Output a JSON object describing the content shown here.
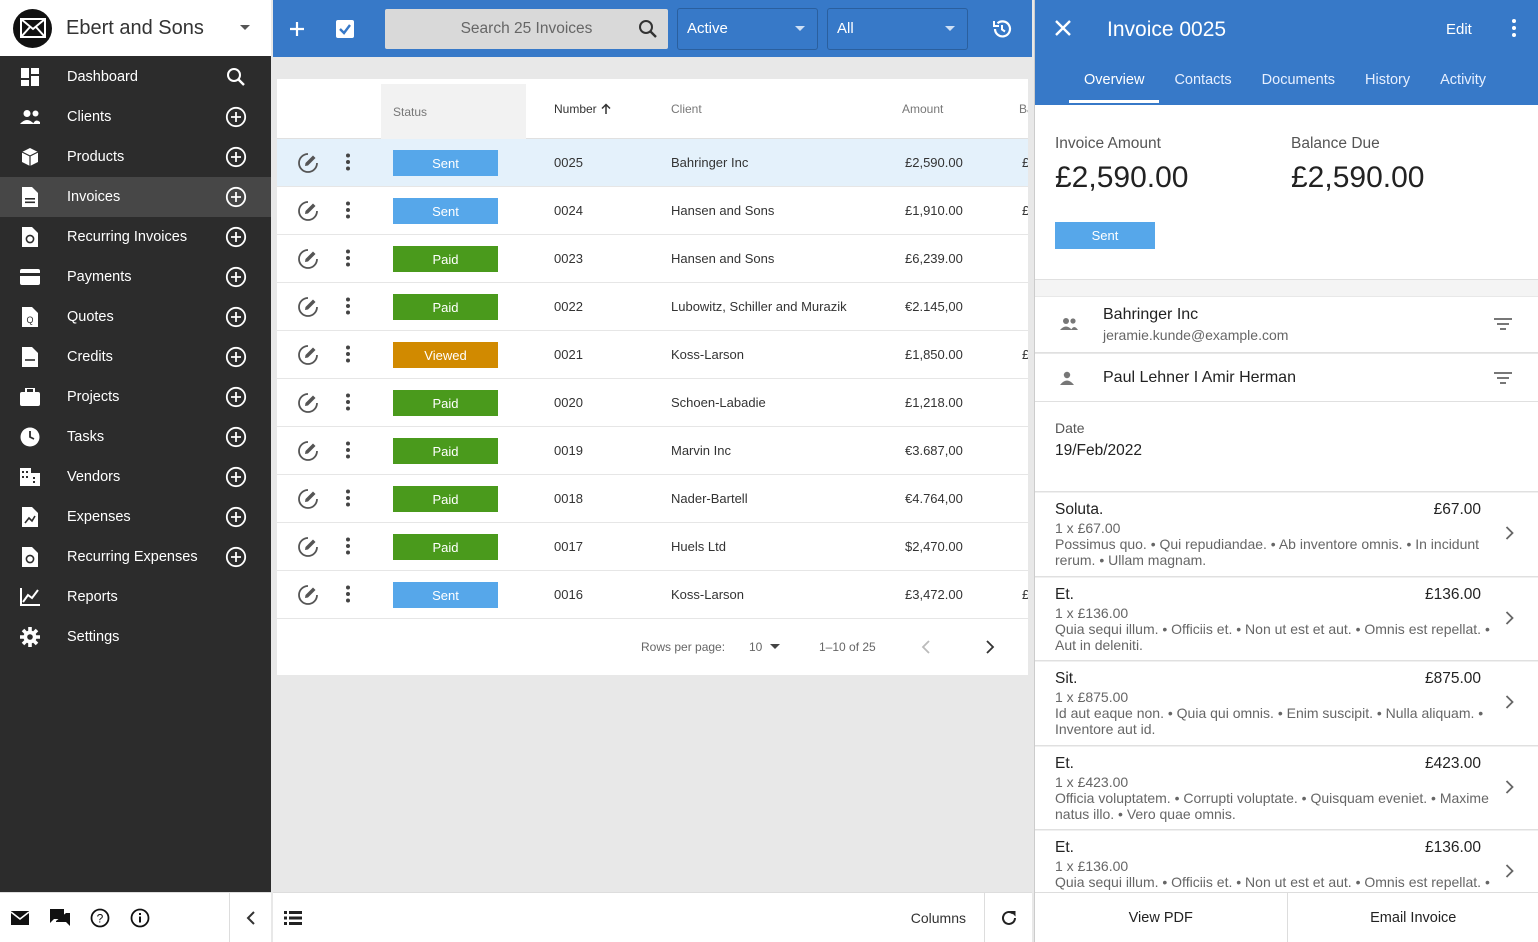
{
  "company": {
    "name": "Ebert and Sons"
  },
  "nav": [
    {
      "label": "Dashboard",
      "icon": "dashboard-icon",
      "action": "search"
    },
    {
      "label": "Clients",
      "icon": "clients-icon",
      "action": "add"
    },
    {
      "label": "Products",
      "icon": "products-icon",
      "action": "add"
    },
    {
      "label": "Invoices",
      "icon": "invoices-icon",
      "action": "add",
      "active": true
    },
    {
      "label": "Recurring Invoices",
      "icon": "recurring-invoices-icon",
      "action": "add"
    },
    {
      "label": "Payments",
      "icon": "payments-icon",
      "action": "add"
    },
    {
      "label": "Quotes",
      "icon": "quotes-icon",
      "action": "add"
    },
    {
      "label": "Credits",
      "icon": "credits-icon",
      "action": "add"
    },
    {
      "label": "Projects",
      "icon": "projects-icon",
      "action": "add"
    },
    {
      "label": "Tasks",
      "icon": "tasks-icon",
      "action": "add"
    },
    {
      "label": "Vendors",
      "icon": "vendors-icon",
      "action": "add"
    },
    {
      "label": "Expenses",
      "icon": "expenses-icon",
      "action": "add"
    },
    {
      "label": "Recurring Expenses",
      "icon": "recurring-expenses-icon",
      "action": "add"
    },
    {
      "label": "Reports",
      "icon": "reports-icon",
      "action": "none"
    },
    {
      "label": "Settings",
      "icon": "settings-icon",
      "action": "none"
    }
  ],
  "topbar": {
    "search_placeholder": "Search 25 Invoices",
    "state_filter": "Active",
    "status_filter": "All"
  },
  "table": {
    "headers": {
      "status": "Status",
      "number": "Number",
      "client": "Client",
      "amount": "Amount",
      "balance": "Ba"
    },
    "rows": [
      {
        "status": "Sent",
        "number": "0025",
        "client": "Bahringer Inc",
        "amount": "£2,590.00",
        "balance": "£",
        "selected": true
      },
      {
        "status": "Sent",
        "number": "0024",
        "client": "Hansen and Sons",
        "amount": "£1,910.00",
        "balance": "£"
      },
      {
        "status": "Paid",
        "number": "0023",
        "client": "Hansen and Sons",
        "amount": "£6,239.00",
        "balance": ""
      },
      {
        "status": "Paid",
        "number": "0022",
        "client": "Lubowitz, Schiller and Murazik",
        "amount": "€2.145,00",
        "balance": ""
      },
      {
        "status": "Viewed",
        "number": "0021",
        "client": "Koss-Larson",
        "amount": "£1,850.00",
        "balance": "£"
      },
      {
        "status": "Paid",
        "number": "0020",
        "client": "Schoen-Labadie",
        "amount": "£1,218.00",
        "balance": ""
      },
      {
        "status": "Paid",
        "number": "0019",
        "client": "Marvin Inc",
        "amount": "€3.687,00",
        "balance": ""
      },
      {
        "status": "Paid",
        "number": "0018",
        "client": "Nader-Bartell",
        "amount": "€4.764,00",
        "balance": ""
      },
      {
        "status": "Paid",
        "number": "0017",
        "client": "Huels Ltd",
        "amount": "$2,470.00",
        "balance": ""
      },
      {
        "status": "Sent",
        "number": "0016",
        "client": "Koss-Larson",
        "amount": "£3,472.00",
        "balance": "£"
      }
    ],
    "status_colors": {
      "Sent": "#56a7ea",
      "Paid": "#4a9a1c",
      "Viewed": "#d18a00"
    }
  },
  "pager": {
    "rows_per_page_label": "Rows per page:",
    "rows_per_page": "10",
    "range": "1–10 of 25"
  },
  "list_footer": {
    "columns_label": "Columns"
  },
  "detail": {
    "title": "Invoice 0025",
    "edit_label": "Edit",
    "tabs": [
      "Overview",
      "Contacts",
      "Documents",
      "History",
      "Activity"
    ],
    "invoice_amount_label": "Invoice Amount",
    "invoice_amount": "£2,590.00",
    "balance_due_label": "Balance Due",
    "balance_due": "£2,590.00",
    "status": "Sent",
    "client_name": "Bahringer Inc",
    "client_email": "jeramie.kunde@example.com",
    "contact_name": "Paul Lehner I Amir Herman",
    "date_label": "Date",
    "date_value": "19/Feb/2022",
    "line_items": [
      {
        "name": "Soluta.",
        "total": "£67.00",
        "qty": "1 x £67.00",
        "desc": "Possimus quo. • Qui repudiandae. • Ab inventore omnis. • In incidunt rerum. • Ullam magnam."
      },
      {
        "name": "Et.",
        "total": "£136.00",
        "qty": "1 x £136.00",
        "desc": "Quia sequi illum. • Officiis et. • Non ut est et aut. • Omnis est repellat. • Aut in deleniti."
      },
      {
        "name": "Sit.",
        "total": "£875.00",
        "qty": "1 x £875.00",
        "desc": "Id aut eaque non. • Quia qui omnis. • Enim suscipit. • Nulla aliquam. • Inventore aut id."
      },
      {
        "name": "Et.",
        "total": "£423.00",
        "qty": "1 x £423.00",
        "desc": "Officia voluptatem. • Corrupti voluptate. • Quisquam eveniet. • Maxime natus illo. • Vero quae omnis."
      },
      {
        "name": "Et.",
        "total": "£136.00",
        "qty": "1 x £136.00",
        "desc": "Quia sequi illum. • Officiis et. • Non ut est et aut. • Omnis est repellat. • Aut in deleniti."
      }
    ],
    "view_pdf_label": "View PDF",
    "email_invoice_label": "Email Invoice"
  },
  "colors": {
    "primary": "#3779c8",
    "sidebar_bg": "#2c2c2c",
    "sidebar_active": "#474747"
  }
}
